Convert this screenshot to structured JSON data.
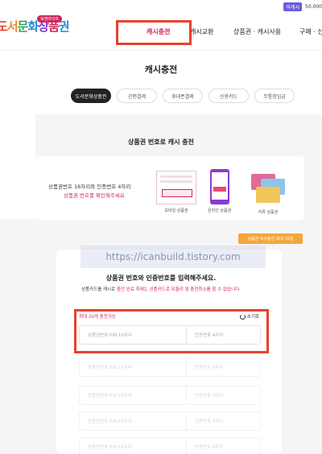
{
  "header": {
    "logo_badge": "북앤라이프",
    "logo_text": "도서문화상품권",
    "util_badge": "마캐시",
    "util_amount": "50,000",
    "nav": [
      {
        "label": "캐시충전",
        "active": true
      },
      {
        "label": "캐시교환",
        "active": false
      },
      {
        "label": "상품권 · 캐시사용",
        "active": false
      },
      {
        "label": "구매 · 선",
        "active": false
      }
    ]
  },
  "page_title": "캐시충전",
  "tabs": [
    {
      "label": "도서문화상품권",
      "active": true
    },
    {
      "label": "간편결제",
      "active": false
    },
    {
      "label": "휴대폰결제",
      "active": false
    },
    {
      "label": "신용카드",
      "active": false
    },
    {
      "label": "무통장입금",
      "active": false
    }
  ],
  "section_title": "상품권 번호로 캐시 충전",
  "info": {
    "line1": "상품권번호 16자리와 인증번호 4자리",
    "line2": "상품권 번호를 확인해주세요",
    "vouchers": [
      {
        "label": "모바일 상품권"
      },
      {
        "label": "온라인 상품권"
      },
      {
        "label": "지류 상품권"
      }
    ]
  },
  "badge_orange": "상품권 복수충전 최대 20장",
  "watermark": "https://icanbuild.tistory.com",
  "form": {
    "title": "상품권 번호와 인증번호를 입력해주세요.",
    "note_dark": "상품카드를 캐시로 ",
    "note_red": "충전 완료 후에는 상품카드로 되돌려 및 충전취소를 할 수 없습니다.",
    "entry_label": "최대 20개 충전가능",
    "reset_label": "초기화",
    "pin_placeholder": "상품권번호 PIN 16자리",
    "auth_placeholder": "인증번호 4자리",
    "rows_faded_pin": "상품권번호 PIN 16자리",
    "rows_faded_auth": "인증번호 4자리"
  },
  "colors": {
    "accent": "#d0255a",
    "highlight": "#e8412c",
    "orange": "#f5a63d"
  }
}
